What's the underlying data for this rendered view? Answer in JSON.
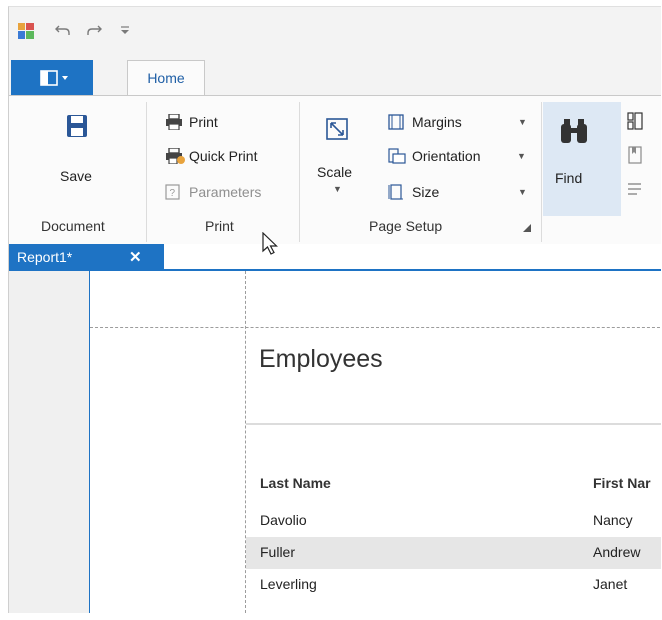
{
  "quick_access": {
    "app_icon": "designer-app-icon",
    "undo_icon": "undo-icon",
    "redo_icon": "redo-icon",
    "customize_icon": "customize-toolbar-icon"
  },
  "tabs": {
    "file_menu_icon": "backstage-menu-icon",
    "home_label": "Home"
  },
  "ribbon": {
    "document_group": {
      "label": "Document",
      "save_label": "Save"
    },
    "print_group": {
      "label": "Print",
      "items": [
        {
          "label": "Print",
          "icon": "printer-icon",
          "enabled": true
        },
        {
          "label": "Quick Print",
          "icon": "quick-print-icon",
          "enabled": true
        },
        {
          "label": "Parameters",
          "icon": "parameters-icon",
          "enabled": false
        }
      ]
    },
    "page_setup_group": {
      "label": "Page Setup",
      "scale_label": "Scale",
      "items": [
        {
          "label": "Margins",
          "icon": "margins-icon"
        },
        {
          "label": "Orientation",
          "icon": "orientation-icon"
        },
        {
          "label": "Size",
          "icon": "page-size-icon"
        }
      ]
    },
    "find_group": {
      "find_label": "Find"
    }
  },
  "document_tab": {
    "label": "Report1*",
    "close": "✕"
  },
  "report": {
    "title": "Employees",
    "columns": [
      "Last Name",
      "First Nar"
    ],
    "rows": [
      [
        "Davolio",
        "Nancy"
      ],
      [
        "Fuller",
        "Andrew"
      ],
      [
        "Leverling",
        "Janet"
      ]
    ]
  },
  "colors": {
    "accent": "#1e73c4",
    "ribbon_bg": "#fbfbfb",
    "alt_row": "#e6e6e6"
  }
}
